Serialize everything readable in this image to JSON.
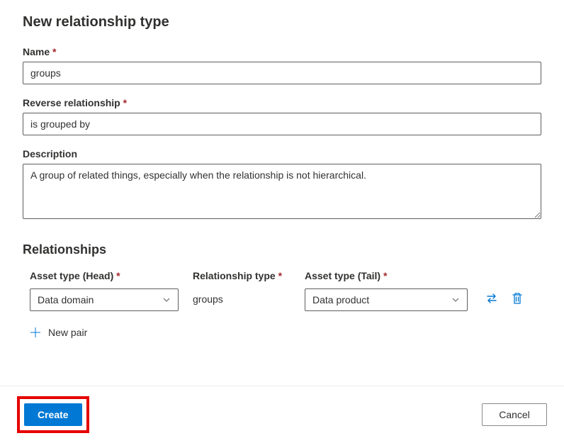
{
  "page": {
    "title": "New relationship type"
  },
  "fields": {
    "name": {
      "label": "Name",
      "value": "groups"
    },
    "reverse": {
      "label": "Reverse relationship",
      "value": "is grouped by"
    },
    "description": {
      "label": "Description",
      "value": "A group of related things, especially when the relationship is not hierarchical."
    }
  },
  "relationships": {
    "section_title": "Relationships",
    "head_label": "Asset type (Head)",
    "type_label": "Relationship type",
    "tail_label": "Asset type (Tail)",
    "rows": [
      {
        "head": "Data domain",
        "type": "groups",
        "tail": "Data product"
      }
    ],
    "new_pair": "New pair"
  },
  "footer": {
    "create": "Create",
    "cancel": "Cancel"
  }
}
